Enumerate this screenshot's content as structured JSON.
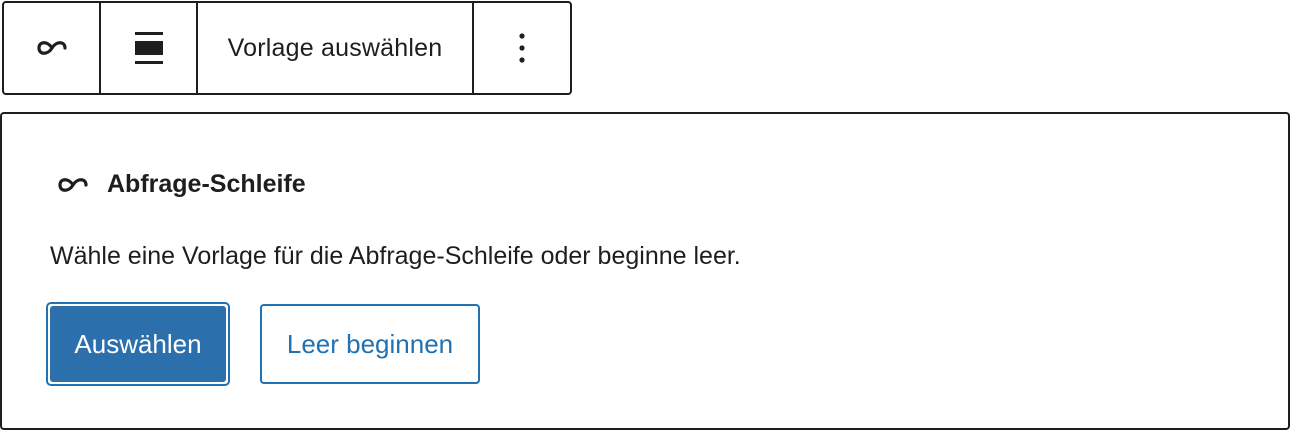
{
  "toolbar": {
    "block_icon": "loop-icon",
    "align_icon": "align-wide-icon",
    "choose_pattern_label": "Vorlage auswählen",
    "more_icon": "more-vertical-icon"
  },
  "placeholder": {
    "icon": "loop-icon",
    "title": "Abfrage-Schleife",
    "description": "Wähle eine Vorlage für die Abfrage-Schleife oder beginne leer.",
    "primary_button_label": "Auswählen",
    "secondary_button_label": "Leer beginnen"
  },
  "colors": {
    "accent": "#2271b1",
    "primary_button_bg": "#2c6fad",
    "text": "#1e1e1e",
    "border": "#1e1e1e"
  }
}
